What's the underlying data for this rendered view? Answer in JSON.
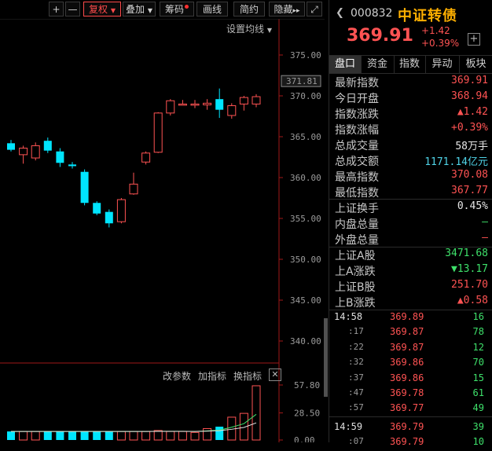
{
  "toolbar": {
    "plus": "+",
    "minus": "—",
    "adjust": "复权",
    "overlay": "叠加",
    "chips": "筹码",
    "draw": "画线",
    "brief": "简约",
    "hide": "隐藏",
    "more": "▸▸",
    "expand": "⤢",
    "ma_setting": "设置均线"
  },
  "price_axis": {
    "ticks": [
      "375.00",
      "370.00",
      "365.00",
      "360.00",
      "355.00",
      "350.00",
      "345.00",
      "340.00"
    ],
    "current": "371.81"
  },
  "volume_axis": {
    "ticks": [
      "57.80",
      "28.50",
      "0.00"
    ]
  },
  "sub_toolbar": {
    "modify_params": "改参数",
    "add_indicator": "加指标",
    "change_indicator": "换指标",
    "close": "✕"
  },
  "colors": {
    "up": "#ff5353",
    "down": "#00e5ff",
    "ma": "#3ee06a"
  },
  "chart_data": {
    "type": "candlestick",
    "ylim": [
      337.5,
      377.5
    ],
    "candles": [
      {
        "open": 364.2,
        "close": 363.4,
        "high": 364.6,
        "low": 363.2
      },
      {
        "open": 362.8,
        "close": 363.6,
        "high": 363.9,
        "low": 361.7
      },
      {
        "open": 362.4,
        "close": 363.9,
        "high": 364.3,
        "low": 362.1
      },
      {
        "open": 364.5,
        "close": 363.3,
        "high": 364.9,
        "low": 363.0
      },
      {
        "open": 363.2,
        "close": 361.8,
        "high": 363.6,
        "low": 361.3
      },
      {
        "open": 361.6,
        "close": 361.4,
        "high": 361.9,
        "low": 361.1
      },
      {
        "open": 360.7,
        "close": 356.9,
        "high": 361.0,
        "low": 356.6
      },
      {
        "open": 356.9,
        "close": 355.6,
        "high": 357.1,
        "low": 355.4
      },
      {
        "open": 355.8,
        "close": 354.4,
        "high": 356.1,
        "low": 353.9
      },
      {
        "open": 354.6,
        "close": 357.3,
        "high": 357.5,
        "low": 354.4
      },
      {
        "open": 358.0,
        "close": 359.2,
        "high": 360.6,
        "low": 357.9
      },
      {
        "open": 361.9,
        "close": 363.0,
        "high": 363.2,
        "low": 361.6
      },
      {
        "open": 363.1,
        "close": 367.9,
        "high": 368.0,
        "low": 363.0
      },
      {
        "open": 367.9,
        "close": 369.4,
        "high": 369.6,
        "low": 367.6
      },
      {
        "open": 369.0,
        "close": 369.0,
        "high": 369.5,
        "low": 368.9
      },
      {
        "open": 368.9,
        "close": 369.0,
        "high": 369.5,
        "low": 368.5
      },
      {
        "open": 368.9,
        "close": 369.1,
        "high": 369.6,
        "low": 368.3
      },
      {
        "open": 369.6,
        "close": 368.3,
        "high": 370.9,
        "low": 367.3
      },
      {
        "open": 367.6,
        "close": 368.8,
        "high": 369.1,
        "low": 367.2
      },
      {
        "open": 369.0,
        "close": 369.8,
        "high": 370.0,
        "low": 368.2
      },
      {
        "open": 369.0,
        "close": 369.9,
        "high": 370.2,
        "low": 368.6
      }
    ],
    "volumes": [
      9,
      9,
      9,
      9,
      9,
      9,
      9,
      9,
      9,
      9,
      9,
      9,
      10,
      9,
      9,
      8,
      12,
      14,
      24,
      28,
      57
    ],
    "volume_ylim": [
      0,
      57.8
    ]
  },
  "quote": {
    "code": "000832",
    "name": "中证转债",
    "price": "369.91",
    "change": "+1.42",
    "change_pct": "+0.39%",
    "add": "+"
  },
  "tabs": [
    "盘口",
    "资金",
    "指数",
    "异动",
    "板块"
  ],
  "stats": [
    {
      "label": "最新指数",
      "value": "369.91",
      "color": "red"
    },
    {
      "label": "今日开盘",
      "value": "368.94",
      "color": "red"
    },
    {
      "label": "指数涨跌",
      "value": "▲1.42",
      "color": "red"
    },
    {
      "label": "指数涨幅",
      "value": "+0.39%",
      "color": "red"
    },
    {
      "label": "总成交量",
      "value": "58万手",
      "color": "white"
    },
    {
      "label": "总成交额",
      "value": "1171.14亿元",
      "color": "cyan"
    },
    {
      "label": "最高指数",
      "value": "370.08",
      "color": "red"
    },
    {
      "label": "最低指数",
      "value": "367.77",
      "color": "red"
    }
  ],
  "stats2": [
    {
      "label": "上证换手",
      "value": "0.45%",
      "color": "white"
    },
    {
      "label": "内盘总量",
      "value": "—",
      "color": "green"
    },
    {
      "label": "外盘总量",
      "value": "—",
      "color": "red"
    }
  ],
  "stats3": [
    {
      "label": "上证A股",
      "value": "3471.68",
      "color": "green"
    },
    {
      "label": "上A涨跌",
      "value": "▼13.17",
      "color": "green"
    },
    {
      "label": "上证B股",
      "value": "251.70",
      "color": "red"
    },
    {
      "label": "上B涨跌",
      "value": "▲0.58",
      "color": "red"
    }
  ],
  "ticks": [
    {
      "time": "14:58",
      "price": "369.89",
      "vol": "16",
      "minor": false
    },
    {
      "time": ":17",
      "price": "369.87",
      "vol": "78",
      "minor": true
    },
    {
      "time": ":22",
      "price": "369.87",
      "vol": "12",
      "minor": true
    },
    {
      "time": ":32",
      "price": "369.86",
      "vol": "70",
      "minor": true
    },
    {
      "time": ":37",
      "price": "369.86",
      "vol": "15",
      "minor": true
    },
    {
      "time": ":47",
      "price": "369.78",
      "vol": "61",
      "minor": true
    },
    {
      "time": ":57",
      "price": "369.77",
      "vol": "49",
      "minor": true
    },
    {
      "time": "14:59",
      "price": "369.79",
      "vol": "39",
      "minor": false
    },
    {
      "time": ":07",
      "price": "369.79",
      "vol": "10",
      "minor": true
    }
  ]
}
